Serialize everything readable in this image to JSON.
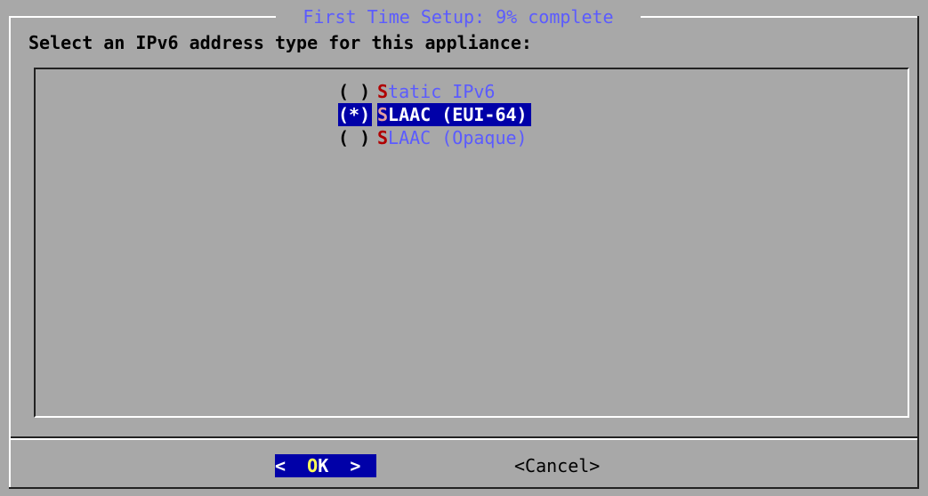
{
  "dialog": {
    "title": "First Time Setup: 9% complete",
    "prompt": "Select an IPv6 address type for this appliance:"
  },
  "options": [
    {
      "radio": "( )",
      "hotkey": "S",
      "rest": "tatic IPv6",
      "selected": false
    },
    {
      "radio": "(*)",
      "hotkey": "S",
      "rest": "LAAC (EUI-64)",
      "selected": true
    },
    {
      "radio": "( )",
      "hotkey": "S",
      "rest": "LAAC (Opaque)",
      "selected": false
    }
  ],
  "buttons": {
    "ok_left": "< ",
    "ok_hotkey": "O",
    "ok_rest": "K",
    "ok_right": "  >",
    "cancel": "<Cancel>"
  },
  "colors": {
    "background": "#a8a8a8",
    "highlight": "#0000a8",
    "title": "#5b5bff",
    "hotkey": "#b00000"
  }
}
